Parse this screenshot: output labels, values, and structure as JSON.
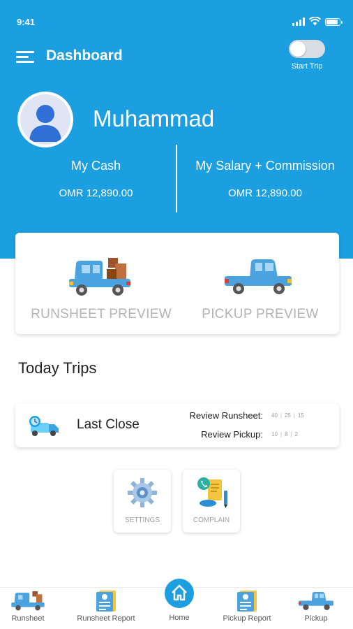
{
  "status_bar": {
    "time": "9:41"
  },
  "header": {
    "title": "Dashboard",
    "toggle_label": "Start Trip",
    "toggle_on": false
  },
  "profile": {
    "name": "Muhammad"
  },
  "stats": [
    {
      "label": "My Cash",
      "value": "OMR 12,890.00"
    },
    {
      "label": "My Salary + Commission",
      "value": "OMR 12,890.00"
    }
  ],
  "previews": [
    {
      "label": "RUNSHEET PREVIEW",
      "icon": "loaded-truck-icon"
    },
    {
      "label": "PICKUP PREVIEW",
      "icon": "pickup-truck-icon"
    }
  ],
  "trips": {
    "title": "Today Trips",
    "last_label": "Last Close",
    "review_runsheet_label": "Review Runsheet:",
    "review_runsheet_counts": [
      "40",
      "25",
      "15"
    ],
    "review_pickup_label": "Review Pickup:",
    "review_pickup_counts": [
      "10",
      "8",
      "2"
    ]
  },
  "tiles": [
    {
      "label": "SETTINGS",
      "icon": "gear-icon"
    },
    {
      "label": "COMPLAIN",
      "icon": "complaint-icon"
    }
  ],
  "bottom_nav": [
    {
      "label": "Runsheet",
      "icon": "loaded-truck-icon"
    },
    {
      "label": "Runsheet Report",
      "icon": "report-icon"
    },
    {
      "label": "Home",
      "icon": "home-icon"
    },
    {
      "label": "Pickup Report",
      "icon": "report-icon"
    },
    {
      "label": "Pickup",
      "icon": "pickup-truck-icon"
    }
  ],
  "colors": {
    "primary": "#1c9fe0",
    "preview_text": "#b3b3b3",
    "tile_text": "#a0a0a0"
  }
}
